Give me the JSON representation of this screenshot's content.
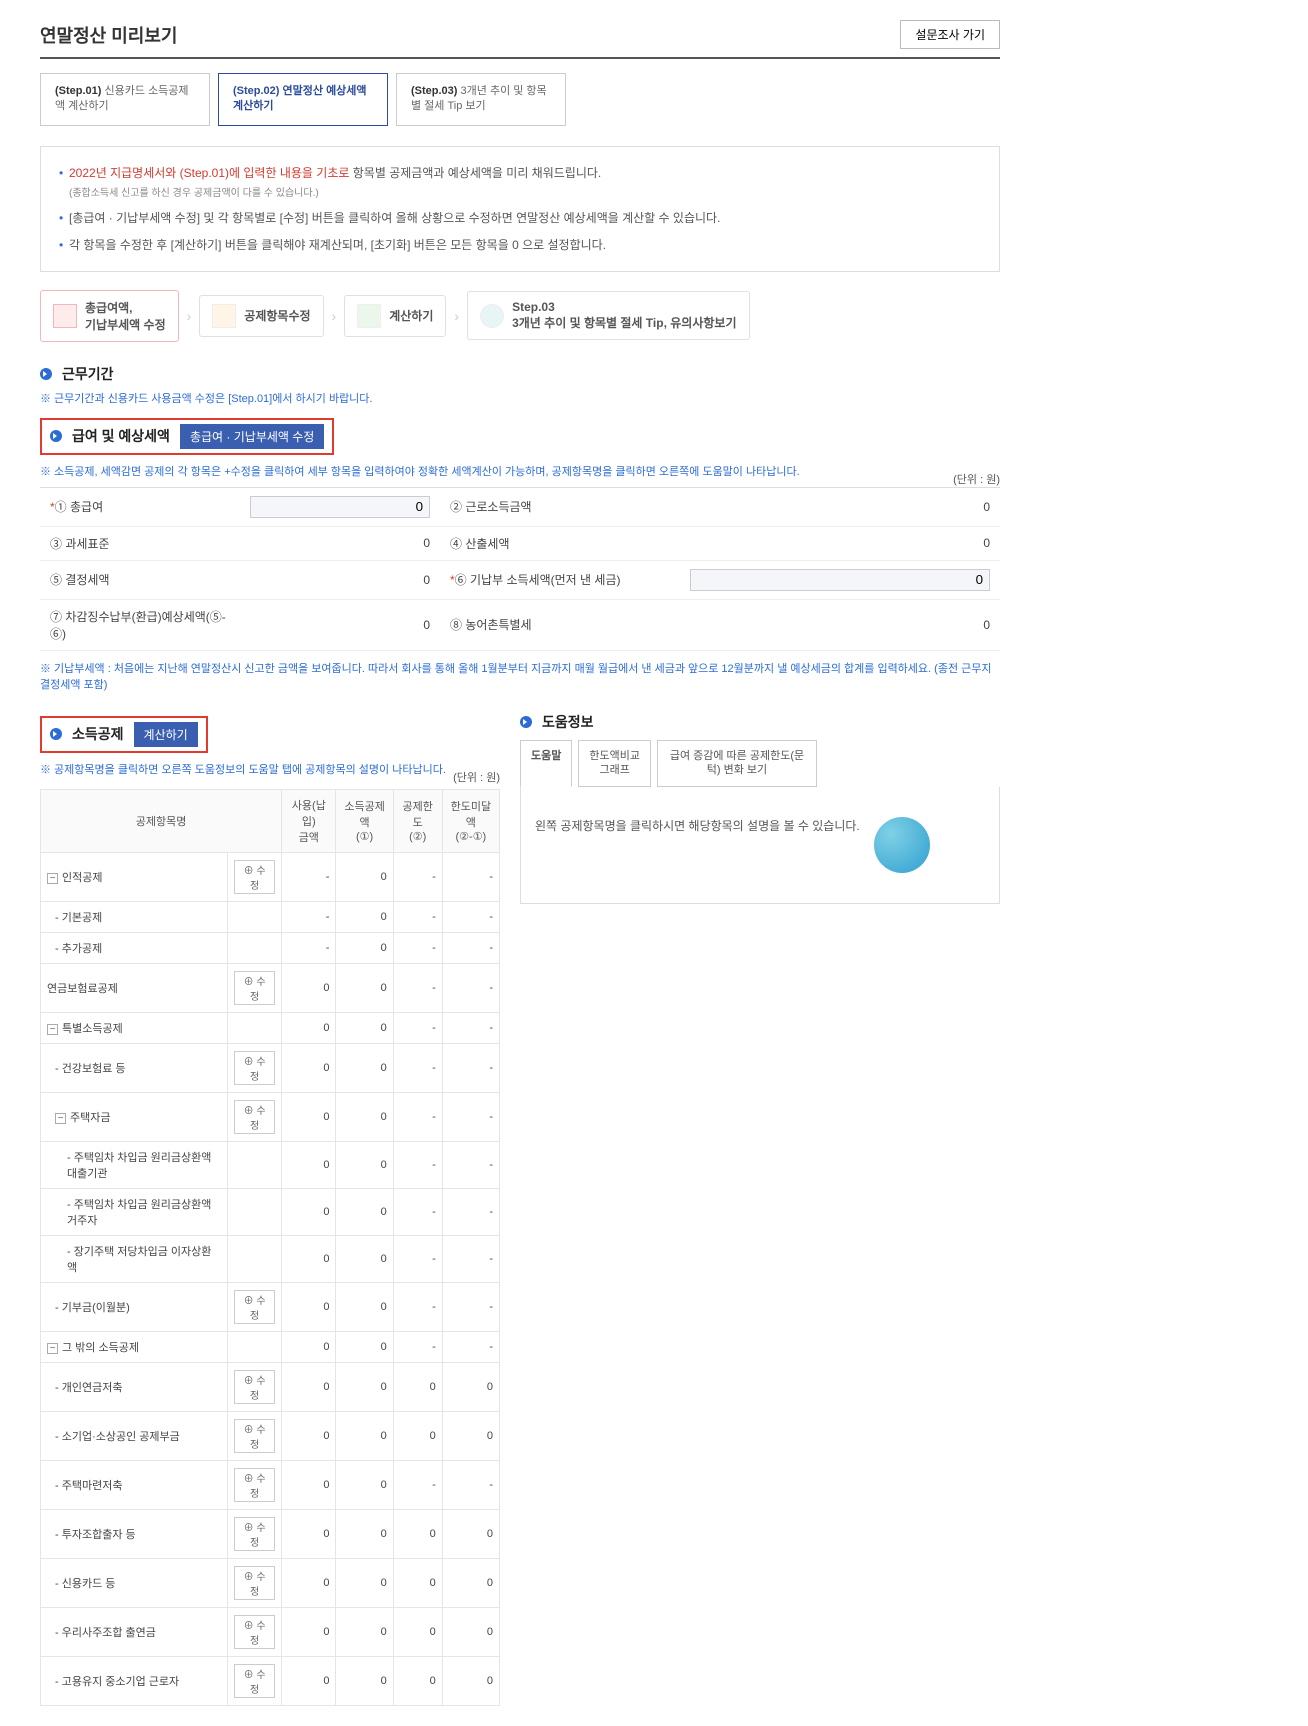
{
  "page_title": "연말정산 미리보기",
  "survey_btn": "설문조사 가기",
  "steps": {
    "s1": {
      "lbl": "(Step.01)",
      "txt": "신용카드 소득공제액 계산하기"
    },
    "s2": {
      "lbl": "(Step.02)",
      "txt": "연말정산 예상세액 계산하기"
    },
    "s3": {
      "lbl": "(Step.03)",
      "txt": "3개년 추이 및 항목별 절세 Tip 보기"
    }
  },
  "info": {
    "li1a": "2022년 지급명세서와 (Step.01)에 입력한 내용을 기초로",
    "li1b": " 항목별 공제금액과 예상세액을 미리 채워드립니다.",
    "li1s": "(종합소득세 신고를 하신 경우 공제금액이 다를 수 있습니다.)",
    "li2": "[총급여 · 기납부세액 수정] 및 각 항목별로 [수정] 버튼을 클릭하여 올해 상황으로 수정하면 연말정산 예상세액을 계산할 수 있습니다.",
    "li3": "각 항목을 수정한 후 [계산하기] 버튼을 클릭해야 재계산되며, [초기화] 버튼은 모든 항목을 0 으로 설정합니다."
  },
  "flow": {
    "c1a": "총급여액,",
    "c1b": "기납부세액 수정",
    "c2": "공제항목수정",
    "c3": "계산하기",
    "c4a": "Step.03",
    "c4b": "3개년 추이 및 항목별 절세 Tip, 유의사항보기"
  },
  "sec_work": "근무기간",
  "work_note": "※ 근무기간과 신용카드 사용금액 수정은 [Step.01]에서 하시기 바랍니다.",
  "sec_salary": "급여 및 예상세액",
  "btn_salary_edit": "총급여 · 기납부세액 수정",
  "salary_note": "※ 소득공제, 세액감면 공제의 각 항목은 +수정을 클릭하여 세부 항목을 입력하여야 정확한 세액계산이 가능하며, 공제항목명을 클릭하면 오른쪽에 도움말이 나타납니다.",
  "unit_won": "(단위 : 원)",
  "tax_rows": {
    "r1l": "① 총급여",
    "r1v": "0",
    "r1rl": "② 근로소득금액",
    "r1rv": "0",
    "r2l": "③ 과세표준",
    "r2v": "0",
    "r2rl": "④ 산출세액",
    "r2rv": "0",
    "r3l": "⑤ 결정세액",
    "r3v": "0",
    "r3rl": "⑥ 기납부 소득세액(먼저 낸 세금)",
    "r3rv": "0",
    "r4l": "⑦ 차감징수납부(환급)예상세액(⑤-⑥)",
    "r4v": "0",
    "r4rl": "⑧ 농어촌특별세",
    "r4rv": "0"
  },
  "prepaid_note": "※ 기납부세액 : 처음에는 지난해 연말정산시 신고한 금액을 보여줍니다. 따라서 회사를 통해 올해 1월분부터 지금까지 매월 월급에서 낸 세금과 앞으로 12월분까지 낼 예상세금의 합계를 입력하세요. (종전 근무지 결정세액 포함)",
  "sec_ded": "소득공제",
  "btn_calc": "계산하기",
  "ded_note_under": "※ 공제항목명을 클릭하면 오른쪽 도움정보의 도움말 탭에 공제항목의 설명이 나타납니다.",
  "ded_head": {
    "c1": "공제항목명",
    "c2": "사용(납입)\n금액",
    "c3": "소득공제액\n(①)",
    "c4": "공제한도\n(②)",
    "c5": "한도미달액\n(②-①)"
  },
  "mod_btn": "⊕ 수정",
  "ded_rows": [
    {
      "name": "인적공제",
      "mod": true,
      "v1": "-",
      "v2": "0",
      "v3": "-",
      "v4": "-",
      "tree": "-",
      "lvl": 0
    },
    {
      "name": "- 기본공제",
      "mod": false,
      "v1": "-",
      "v2": "0",
      "v3": "-",
      "v4": "-",
      "lvl": 1
    },
    {
      "name": "- 추가공제",
      "mod": false,
      "v1": "-",
      "v2": "0",
      "v3": "-",
      "v4": "-",
      "lvl": 1
    },
    {
      "name": "연금보험료공제",
      "mod": true,
      "v1": "0",
      "v2": "0",
      "v3": "-",
      "v4": "-",
      "lvl": 0
    },
    {
      "name": "특별소득공제",
      "mod": false,
      "v1": "0",
      "v2": "0",
      "v3": "-",
      "v4": "-",
      "tree": "-",
      "lvl": 0
    },
    {
      "name": "- 건강보험료 등",
      "mod": true,
      "v1": "0",
      "v2": "0",
      "v3": "-",
      "v4": "-",
      "lvl": 1
    },
    {
      "name": "주택자금",
      "mod": true,
      "v1": "0",
      "v2": "0",
      "v3": "-",
      "v4": "-",
      "tree": "-",
      "lvl": 1
    },
    {
      "name": "- 주택임차 차입금 원리금상환액 대출기관",
      "mod": false,
      "v1": "0",
      "v2": "0",
      "v3": "-",
      "v4": "-",
      "lvl": 2
    },
    {
      "name": "- 주택임차 차입금 원리금상환액 거주자",
      "mod": false,
      "v1": "0",
      "v2": "0",
      "v3": "-",
      "v4": "-",
      "lvl": 2
    },
    {
      "name": "- 장기주택 저당차입금 이자상환액",
      "mod": false,
      "v1": "0",
      "v2": "0",
      "v3": "-",
      "v4": "-",
      "lvl": 2
    },
    {
      "name": "- 기부금(이월분)",
      "mod": true,
      "v1": "0",
      "v2": "0",
      "v3": "-",
      "v4": "-",
      "lvl": 1
    },
    {
      "name": "그 밖의 소득공제",
      "mod": false,
      "v1": "0",
      "v2": "0",
      "v3": "-",
      "v4": "-",
      "tree": "-",
      "lvl": 0
    },
    {
      "name": "- 개인연금저축",
      "mod": true,
      "v1": "0",
      "v2": "0",
      "v3": "0",
      "v4": "0",
      "lvl": 1
    },
    {
      "name": "- 소기업·소상공인 공제부금",
      "mod": true,
      "v1": "0",
      "v2": "0",
      "v3": "0",
      "v4": "0",
      "lvl": 1
    },
    {
      "name": "- 주택마련저축",
      "mod": true,
      "v1": "0",
      "v2": "0",
      "v3": "-",
      "v4": "-",
      "lvl": 1
    },
    {
      "name": "- 투자조합출자 등",
      "mod": true,
      "v1": "0",
      "v2": "0",
      "v3": "0",
      "v4": "0",
      "lvl": 1
    },
    {
      "name": "- 신용카드 등",
      "mod": true,
      "v1": "0",
      "v2": "0",
      "v3": "0",
      "v4": "0",
      "lvl": 1
    },
    {
      "name": "- 우리사주조합 출연금",
      "mod": true,
      "v1": "0",
      "v2": "0",
      "v3": "0",
      "v4": "0",
      "lvl": 1
    },
    {
      "name": "- 고용유지 중소기업 근로자",
      "mod": true,
      "v1": "0",
      "v2": "0",
      "v3": "0",
      "v4": "0",
      "lvl": 1
    }
  ],
  "help_title": "도움정보",
  "help_tabs": {
    "t1": "도움말",
    "t2": "한도액비교\n그래프",
    "t3": "급여 증감에 따른 공제한도(문턱) 변화 보기"
  },
  "help_body": "왼쪽 공제항목명을 클릭하시면 해당항목의 설명을 볼 수 있습니다."
}
